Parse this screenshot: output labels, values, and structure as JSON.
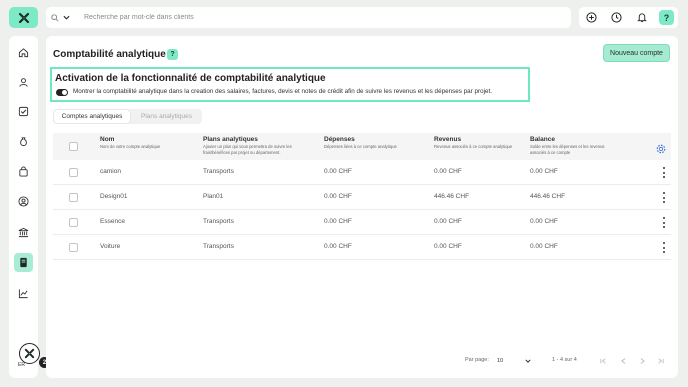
{
  "search": {
    "placeholder": "Recherche par mot-clé dans clients"
  },
  "header": {
    "icons": [
      "plus-circle-icon",
      "clock-icon",
      "bell-icon",
      "help-icon"
    ],
    "help_label": "?"
  },
  "sidebar": {
    "items": [
      {
        "icon": "home-icon",
        "active": false
      },
      {
        "icon": "contacts-icon",
        "active": false
      },
      {
        "icon": "checkbox-icon",
        "active": false
      },
      {
        "icon": "money-bag-icon",
        "active": false
      },
      {
        "icon": "shopping-bag-icon",
        "active": false
      },
      {
        "icon": "user-circle-icon",
        "active": false
      },
      {
        "icon": "bank-icon",
        "active": false
      },
      {
        "icon": "ledger-icon",
        "active": true
      },
      {
        "icon": "chart-line-icon",
        "active": false
      }
    ],
    "avatar": {
      "initials": "ER",
      "badge": "2"
    }
  },
  "page": {
    "title": "Comptabilité analytique",
    "help": "?",
    "new_button": "Nouveau compte"
  },
  "activation": {
    "title": "Activation de la fonctionnalité de comptabilité analytique",
    "description": "Montrer la comptabilité analytique dans la creation des salaires, factures, devis et notes de crédit afin de suivre les revenus et les dépenses par projet.",
    "enabled": true
  },
  "tabs": [
    {
      "label": "Comptes analytiques",
      "active": true
    },
    {
      "label": "Plans analytiques",
      "active": false
    }
  ],
  "table": {
    "columns": [
      {
        "title": "Nom",
        "subtitle": "Nom de votre compte analytique"
      },
      {
        "title": "Plans analytiques",
        "subtitle": "Ajouter un plan qui vous permettra de suivre les frais/bénéfices par projet ou département."
      },
      {
        "title": "Dépenses",
        "subtitle": "Dépenses liées à ce compte analytique"
      },
      {
        "title": "Revenus",
        "subtitle": "Revenus associés à ce compte analytique"
      },
      {
        "title": "Balance",
        "subtitle": "Solde entre les dépenses et les revenus associés à ce compte"
      }
    ],
    "rows": [
      {
        "name": "camion",
        "plan": "Transports",
        "depenses": "0.00 CHF",
        "revenus": "0.00 CHF",
        "balance": "0.00 CHF"
      },
      {
        "name": "Design01",
        "plan": "Plan01",
        "depenses": "0.00 CHF",
        "revenus": "446.46 CHF",
        "balance": "446.46 CHF"
      },
      {
        "name": "Essence",
        "plan": "Transports",
        "depenses": "0.00 CHF",
        "revenus": "0.00 CHF",
        "balance": "0.00 CHF"
      },
      {
        "name": "Voiture",
        "plan": "Transports",
        "depenses": "0.00 CHF",
        "revenus": "0.00 CHF",
        "balance": "0.00 CHF"
      }
    ]
  },
  "pagination": {
    "per_page_label": "Par page:",
    "per_page_value": "10",
    "range": "1 - 4 sur 4"
  },
  "colors": {
    "accent": "#7ee9c6",
    "highlight_border": "#6de8bf",
    "active_nav": "#a9ecd6"
  }
}
